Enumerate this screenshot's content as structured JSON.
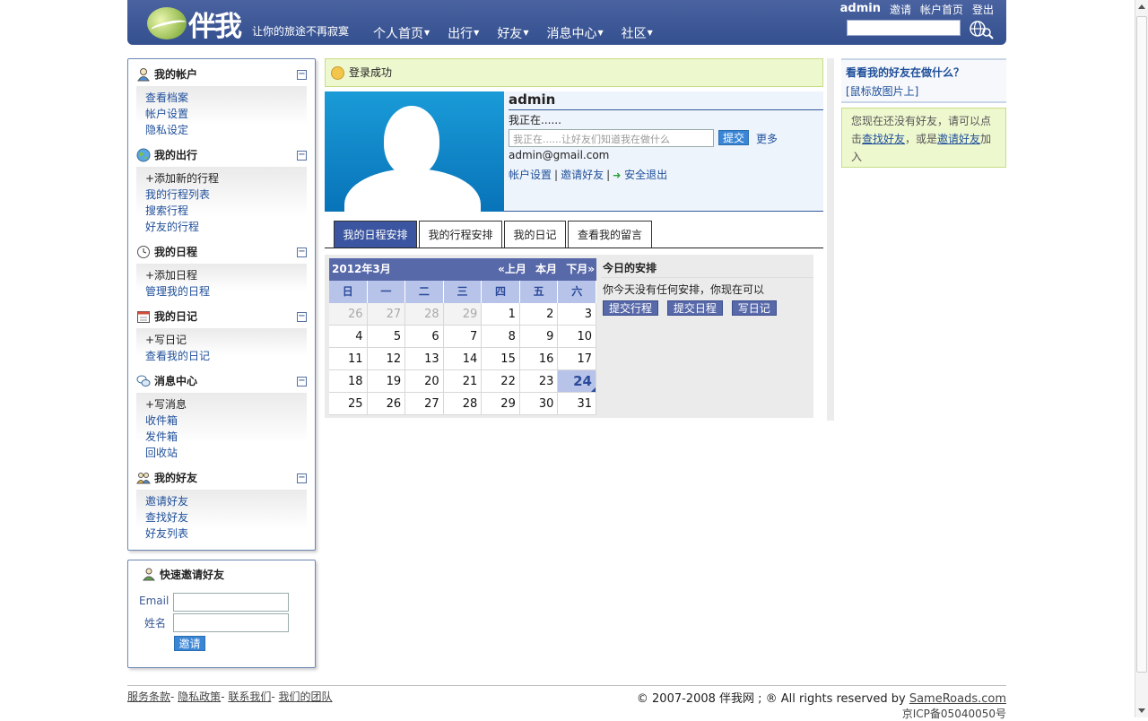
{
  "header": {
    "logo_text": "伴我",
    "slogan": "让你的旅途不再寂寞",
    "nav": [
      {
        "label": "个人首页"
      },
      {
        "label": "出行"
      },
      {
        "label": "好友"
      },
      {
        "label": "消息中心"
      },
      {
        "label": "社区"
      }
    ],
    "user": "admin",
    "links": {
      "invite": "邀请",
      "account_home": "帐户首页",
      "logout": "登出"
    },
    "search_value": ""
  },
  "sidebar": {
    "sections": [
      {
        "title": "我的帐户",
        "icon": "user-icon",
        "items": [
          "查看档案",
          "帐户设置",
          "隐私设定"
        ]
      },
      {
        "title": "我的出行",
        "icon": "globe-icon",
        "items": [
          "+添加新的行程",
          "我的行程列表",
          "搜索行程",
          "好友的行程"
        ]
      },
      {
        "title": "我的日程",
        "icon": "clock-icon",
        "items": [
          "+添加日程",
          "管理我的日程"
        ]
      },
      {
        "title": "我的日记",
        "icon": "calendar-icon",
        "items": [
          "+写日记",
          "查看我的日记"
        ]
      },
      {
        "title": "消息中心",
        "icon": "chat-icon",
        "items": [
          "+写消息",
          "收件箱",
          "发件箱",
          "回收站"
        ]
      },
      {
        "title": "我的好友",
        "icon": "friends-icon",
        "items": [
          "邀请好友",
          "查找好友",
          "好友列表"
        ]
      }
    ]
  },
  "invite": {
    "title": "快速邀请好友",
    "email_label": "Email",
    "name_label": "姓名",
    "button": "邀请"
  },
  "main": {
    "success": "登录成功",
    "profile": {
      "name": "admin",
      "doing": "我正在......",
      "status_placeholder": "我正在......让好友们知道我在做什么",
      "submit": "提交",
      "more": "更多",
      "email": "admin@gmail.com",
      "account_settings": "帐户设置",
      "invite_friends": "邀请好友",
      "logout": "安全退出"
    },
    "tabs": [
      "我的日程安排",
      "我的行程安排",
      "我的日记",
      "查看我的留言"
    ],
    "calendar": {
      "month": "2012年3月",
      "prev": "«上月",
      "current": "本月",
      "next": "下月»",
      "weekdays": [
        "日",
        "一",
        "二",
        "三",
        "四",
        "五",
        "六"
      ],
      "days": [
        [
          "26",
          "27",
          "28",
          "29",
          "1",
          "2",
          "3"
        ],
        [
          "4",
          "5",
          "6",
          "7",
          "8",
          "9",
          "10"
        ],
        [
          "11",
          "12",
          "13",
          "14",
          "15",
          "16",
          "17"
        ],
        [
          "18",
          "19",
          "20",
          "21",
          "22",
          "23",
          "24"
        ],
        [
          "25",
          "26",
          "27",
          "28",
          "29",
          "30",
          "31"
        ]
      ],
      "today": "24"
    },
    "today_title": "今日的安排",
    "today_text": "你今天没有任何安排，你现在可以",
    "actions": [
      "提交行程",
      "提交日程",
      "写日记"
    ]
  },
  "right": {
    "friends_title": "看看我的好友在做什么？",
    "hint": "[鼠标放图片上]",
    "no_friends_pre": "您现在还没有好友，请可以点击",
    "find_friends": "查找好友",
    "middle": "，或是",
    "invite_friends": "邀请好友",
    "suffix": "加入"
  },
  "footer": {
    "links": [
      "服务条款",
      "隐私政策",
      "联系我们",
      "我们的团队"
    ],
    "copyright": "© 2007-2008 伴我网 ; ® All rights reserved by ",
    "company": "SameRoads.com",
    "icp": "京ICP备05040050号"
  }
}
